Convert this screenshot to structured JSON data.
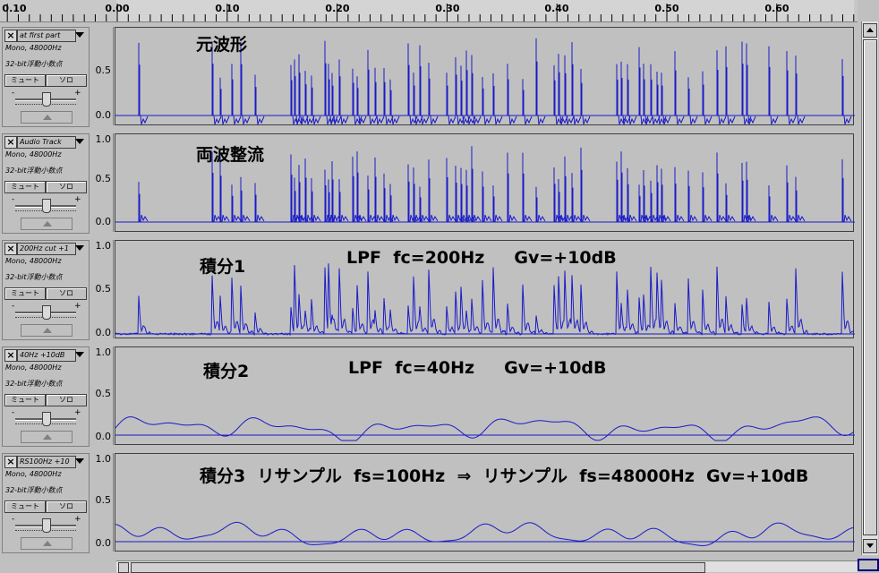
{
  "ruler": {
    "ticks": [
      "0.10",
      "0.00",
      "0.10",
      "0.20",
      "0.30",
      "0.40",
      "0.50",
      "0.60"
    ]
  },
  "colors": {
    "waveform": "#1a1ac8",
    "background": "#c0c0c0",
    "axis_line": "#000000"
  },
  "tracks": [
    {
      "name": "at first  part",
      "info1": "Mono, 48000Hz",
      "info2": "32-bit浮動小数点",
      "mute": "ミュート",
      "solo": "ソロ",
      "minus": "-",
      "plus": "+",
      "y_top": "",
      "y_mid": "0.5",
      "y_zero": "0.0",
      "annotation": "元波形",
      "kind": "raw"
    },
    {
      "name": "Audio Track",
      "info1": "Mono, 48000Hz",
      "info2": "32-bit浮動小数点",
      "mute": "ミュート",
      "solo": "ソロ",
      "minus": "-",
      "plus": "+",
      "y_top": "1.0",
      "y_mid": "0.5",
      "y_zero": "0.0",
      "annotation": "両波整流",
      "kind": "rect"
    },
    {
      "name": "200Hz cut +1",
      "info1": "Mono, 48000Hz",
      "info2": "32-bit浮動小数点",
      "mute": "ミュート",
      "solo": "ソロ",
      "minus": "-",
      "plus": "+",
      "y_top": "1.0",
      "y_mid": "0.5",
      "y_zero": "0.0",
      "annotation": "積分1",
      "annotation2": "LPF  fc=200Hz     Gv=+10dB",
      "kind": "lpf200"
    },
    {
      "name": "40Hz +10dB",
      "info1": "Mono, 48000Hz",
      "info2": "32-bit浮動小数点",
      "mute": "ミュート",
      "solo": "ソロ",
      "minus": "-",
      "plus": "+",
      "y_top": "1.0",
      "y_mid": "0.5",
      "y_zero": "0.0",
      "annotation": "積分2",
      "annotation2": "LPF  fc=40Hz     Gv=+10dB",
      "kind": "lpf40"
    },
    {
      "name": "RS100Hz +10",
      "info1": "Mono, 48000Hz",
      "info2": "32-bit浮動小数点",
      "mute": "ミュート",
      "solo": "ソロ",
      "minus": "-",
      "plus": "+",
      "y_top": "1.0",
      "y_mid": "0.5",
      "y_zero": "0.0",
      "annotation": "積分3  リサンプル  fs=100Hz  ⇒  リサンプル  fs=48000Hz  Gv=+10dB",
      "kind": "resample"
    }
  ]
}
